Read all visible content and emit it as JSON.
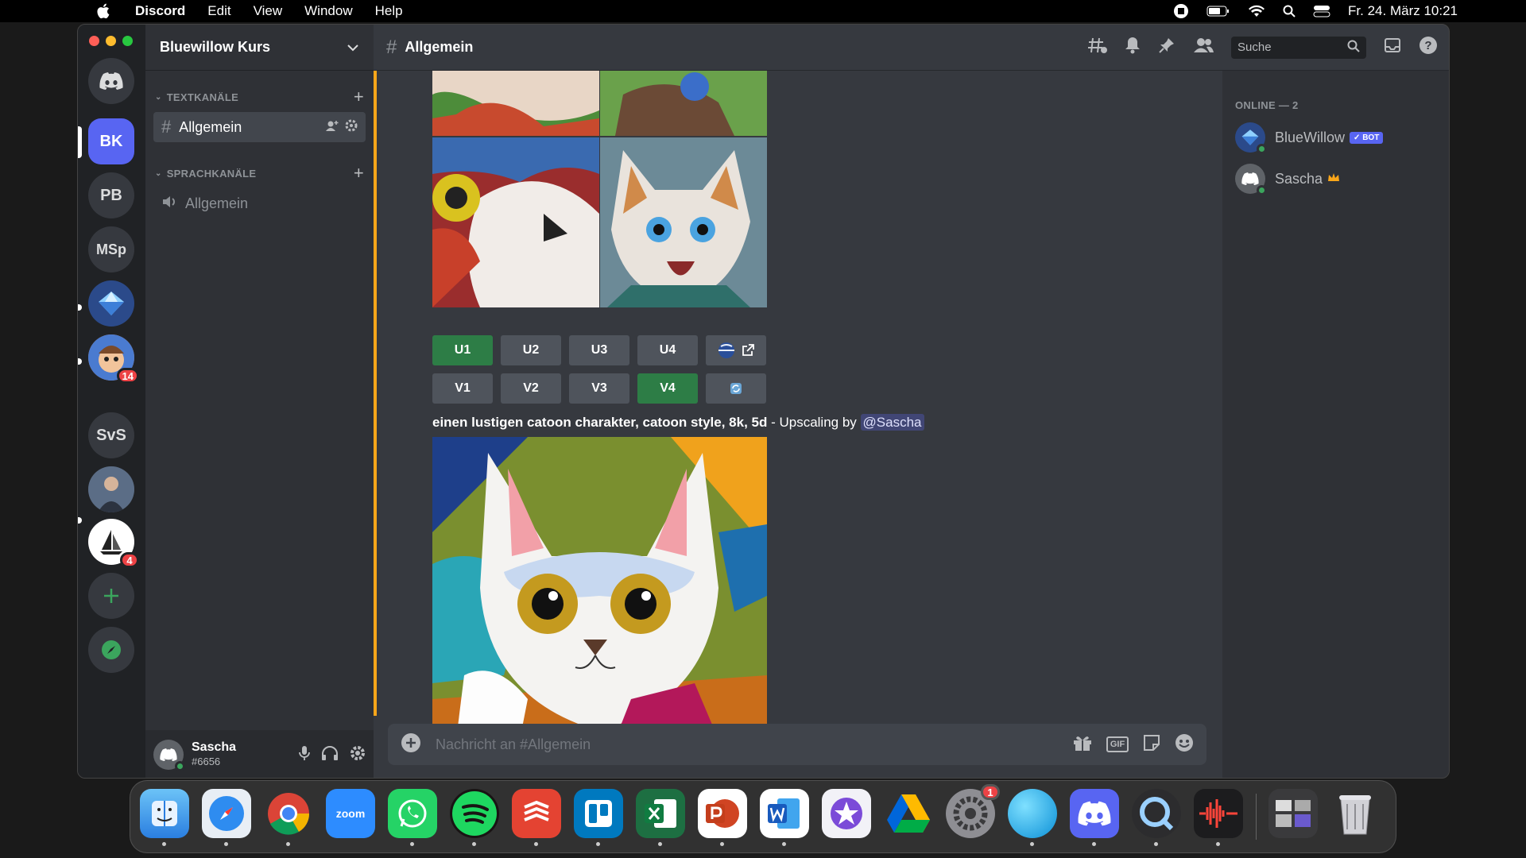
{
  "menubar": {
    "app_name": "Discord",
    "items": [
      "Edit",
      "View",
      "Window",
      "Help"
    ],
    "datetime": "Fr. 24. März 10:21"
  },
  "servers": {
    "active": "BK",
    "list": [
      {
        "label": "BK",
        "badge": ""
      },
      {
        "label": "PB",
        "badge": ""
      },
      {
        "label": "MSp",
        "badge": ""
      },
      {
        "label": "",
        "badge": ""
      },
      {
        "label": "",
        "badge": "14"
      },
      {
        "label": "SvS",
        "badge": ""
      },
      {
        "label": "",
        "badge": ""
      },
      {
        "label": "",
        "badge": "4"
      }
    ]
  },
  "guild": {
    "name": "Bluewillow Kurs",
    "text_category": "TEXTKANÄLE",
    "text_channel": "Allgemein",
    "voice_category": "SPRACHKANÄLE",
    "voice_channel": "Allgemein"
  },
  "user": {
    "name": "Sascha",
    "tag": "#6656"
  },
  "header": {
    "channel": "Allgemein",
    "search_placeholder": "Suche"
  },
  "message": {
    "upscale_buttons": [
      "U1",
      "U2",
      "U3",
      "U4"
    ],
    "variation_buttons": [
      "V1",
      "V2",
      "V3",
      "V4"
    ],
    "active_upscale": "U1",
    "active_variation": "V4",
    "caption_bold": "einen lustigen catoon charakter, catoon style, 8k, 5d",
    "caption_rest": " - Upscaling by ",
    "mention": "@Sascha"
  },
  "composer": {
    "placeholder": "Nachricht an #Allgemein",
    "gif_label": "GIF"
  },
  "members": {
    "heading": "ONLINE — 2",
    "list": [
      {
        "name": "BlueWillow",
        "badge": "✓ BOT"
      },
      {
        "name": "Sascha",
        "badge": ""
      }
    ]
  },
  "dock": {
    "zoom_label": "zoom",
    "settings_badge": "1"
  },
  "colors": {
    "blurple": "#5865f2",
    "green_button": "#2d7d46",
    "highlight_bar": "#faa61a"
  }
}
